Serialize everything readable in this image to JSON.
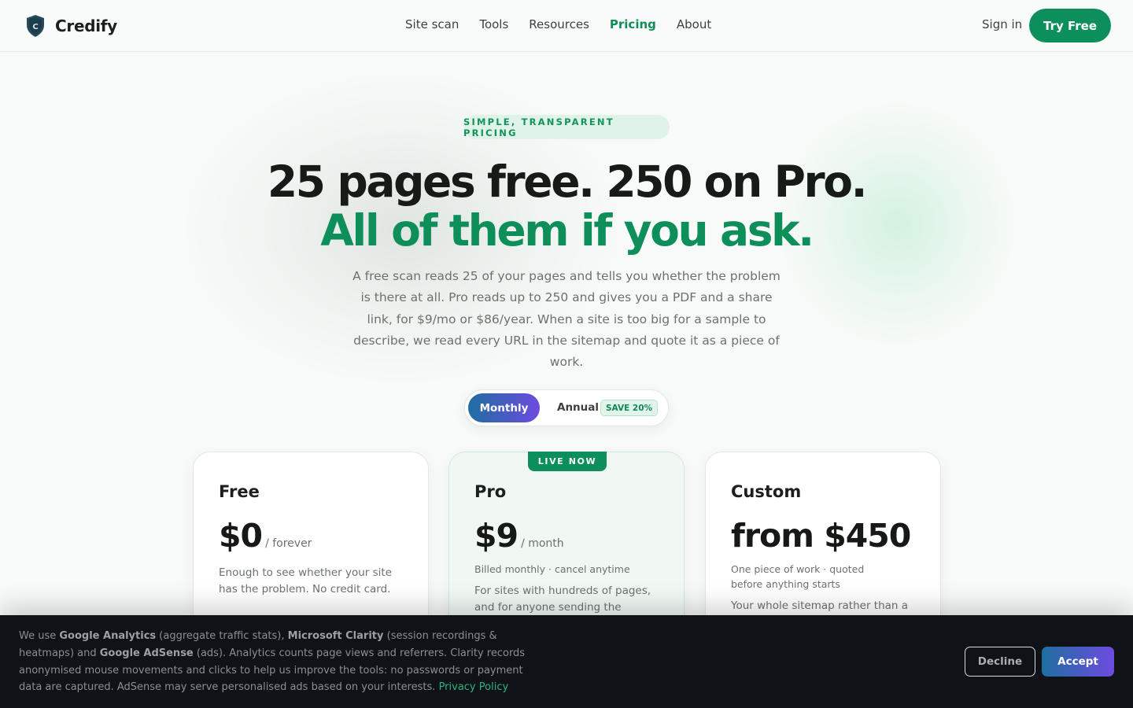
{
  "header": {
    "brand_name": "Credify",
    "nav": [
      "Site scan",
      "Tools",
      "Resources",
      "Pricing",
      "About"
    ],
    "active_nav": "Pricing",
    "sign_in": "Sign in",
    "try_free": "Try Free"
  },
  "hero": {
    "eyebrow": "SIMPLE, TRANSPARENT PRICING",
    "headline_1": "25 pages free. 250 on Pro.",
    "headline_2": "All of them if you ask.",
    "lede": "A free scan reads 25 of your pages and tells you whether the problem is there at all. Pro reads up to 250 and gives you a PDF and a share link, for $9/mo or $86/year. When a site is too big for a sample to describe, we read every URL in the sitemap and quote it as a piece of work."
  },
  "billing_toggle": {
    "monthly": "Monthly",
    "annual": "Annual",
    "save_badge": "SAVE 20%",
    "selected": "Monthly"
  },
  "plans": [
    {
      "name": "Free",
      "price": "$0",
      "unit": "/ forever",
      "description": "Enough to see whether your site has the problem. No credit card."
    },
    {
      "name": "Pro",
      "badge": "LIVE NOW",
      "price": "$9",
      "unit": "/ month",
      "billed": "Billed monthly · cancel anytime",
      "description": "For sites with hundreds of pages, and for anyone sending the findings to a"
    },
    {
      "name": "Custom",
      "price": "from $450",
      "billed": "One piece of work · quoted before anything starts",
      "description": "Your whole sitemap rather than a"
    }
  ],
  "cookie_banner": {
    "intro": "We use ",
    "ga": "Google Analytics",
    "ga_note": " (aggregate traffic stats), ",
    "clarity": "Microsoft Clarity",
    "clarity_note": " (session recordings & heatmaps) and ",
    "adsense": "Google AdSense",
    "rest": " (ads). Analytics counts page views and referrers. Clarity records anonymised mouse movements and clicks to help us improve the tools: no passwords or payment data are captured. AdSense may serve personalised ads based on your interests. ",
    "privacy_link": "Privacy Policy",
    "decline": "Decline",
    "accept": "Accept"
  },
  "colors": {
    "brand_green": "#0e8f5a",
    "accent_gradient_start": "#1f6ea0",
    "accent_gradient_end": "#6d4be0",
    "cookie_bg": "#0f1318"
  }
}
